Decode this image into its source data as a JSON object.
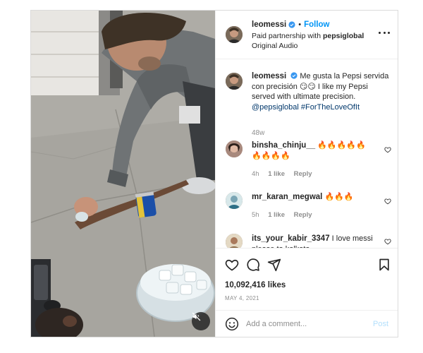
{
  "colors": {
    "accent": "#0095f6",
    "verified": "#3897f0",
    "text": "#262626",
    "muted": "#8e8e8e",
    "hashtag": "#00376b",
    "post_disabled": "#b2dffc",
    "fire": "#f5731c"
  },
  "media": {
    "mute_icon": "speaker-muted-icon"
  },
  "header": {
    "username": "leomessi",
    "follow_label": "Follow",
    "partnership_prefix": "Paid partnership with",
    "partner": "pepsiglobal",
    "audio": "Original Audio",
    "more_icon": "more-options-icon"
  },
  "caption": {
    "username": "leomessi",
    "text_1": "Me gusta la Pepsi servida con precisión",
    "emojis": "😏😏",
    "text_2": "I like my Pepsi served with ultimate precision.",
    "mention": "@pepsiglobal",
    "hashtag": "#ForTheLoveOfIt",
    "time": "48w"
  },
  "comments": [
    {
      "username": "binsha_chinju__",
      "text": "🔥🔥🔥🔥🔥🔥🔥🔥🔥",
      "time": "4h",
      "likes": "1 like",
      "reply": "Reply"
    },
    {
      "username": "mr_karan_megwal",
      "text": "🔥🔥🔥",
      "time": "5h",
      "likes": "1 like",
      "reply": "Reply"
    },
    {
      "username": "its_your_kabir_3347",
      "text": "I love messi please to kolkata"
    }
  ],
  "actions": {
    "like_icon": "heart-icon",
    "comment_icon": "comment-icon",
    "share_icon": "share-icon",
    "save_icon": "bookmark-icon",
    "likes": "10,092,416 likes",
    "date": "MAY 4, 2021"
  },
  "add_comment": {
    "emoji_icon": "emoji-icon",
    "placeholder": "Add a comment...",
    "post_label": "Post"
  }
}
